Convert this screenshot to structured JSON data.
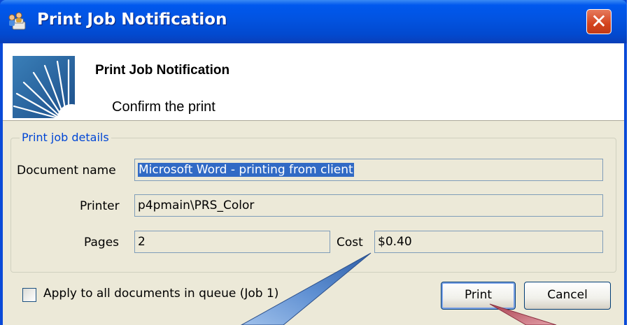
{
  "window": {
    "title": "Print Job Notification",
    "title_icon": "printer-people-icon",
    "close_icon": "close-x-icon",
    "close_glyph": "✕"
  },
  "header": {
    "title": "Print Job Notification",
    "subtitle": "Confirm the print",
    "logo_icon": "sunburst-logo-icon"
  },
  "details": {
    "group_label": "Print job details",
    "document_name_label": "Document name",
    "document_name_value": "Microsoft Word - printing from client",
    "printer_label": "Printer",
    "printer_value": "p4pmain\\PRS_Color",
    "pages_label": "Pages",
    "pages_value": "2",
    "cost_label": "Cost",
    "cost_value": "$0.40"
  },
  "footer": {
    "apply_all_label": "Apply to all documents in queue (Job 1)",
    "apply_all_checked": false,
    "print_button": "Print",
    "cancel_button": "Cancel"
  },
  "colors": {
    "titlebar": "#0253e0",
    "client_bg": "#ece9d8",
    "group_label": "#0046d5",
    "selection": "#316ac5",
    "callout_blue": "#6e9bd8",
    "callout_red": "#c75a6a"
  }
}
